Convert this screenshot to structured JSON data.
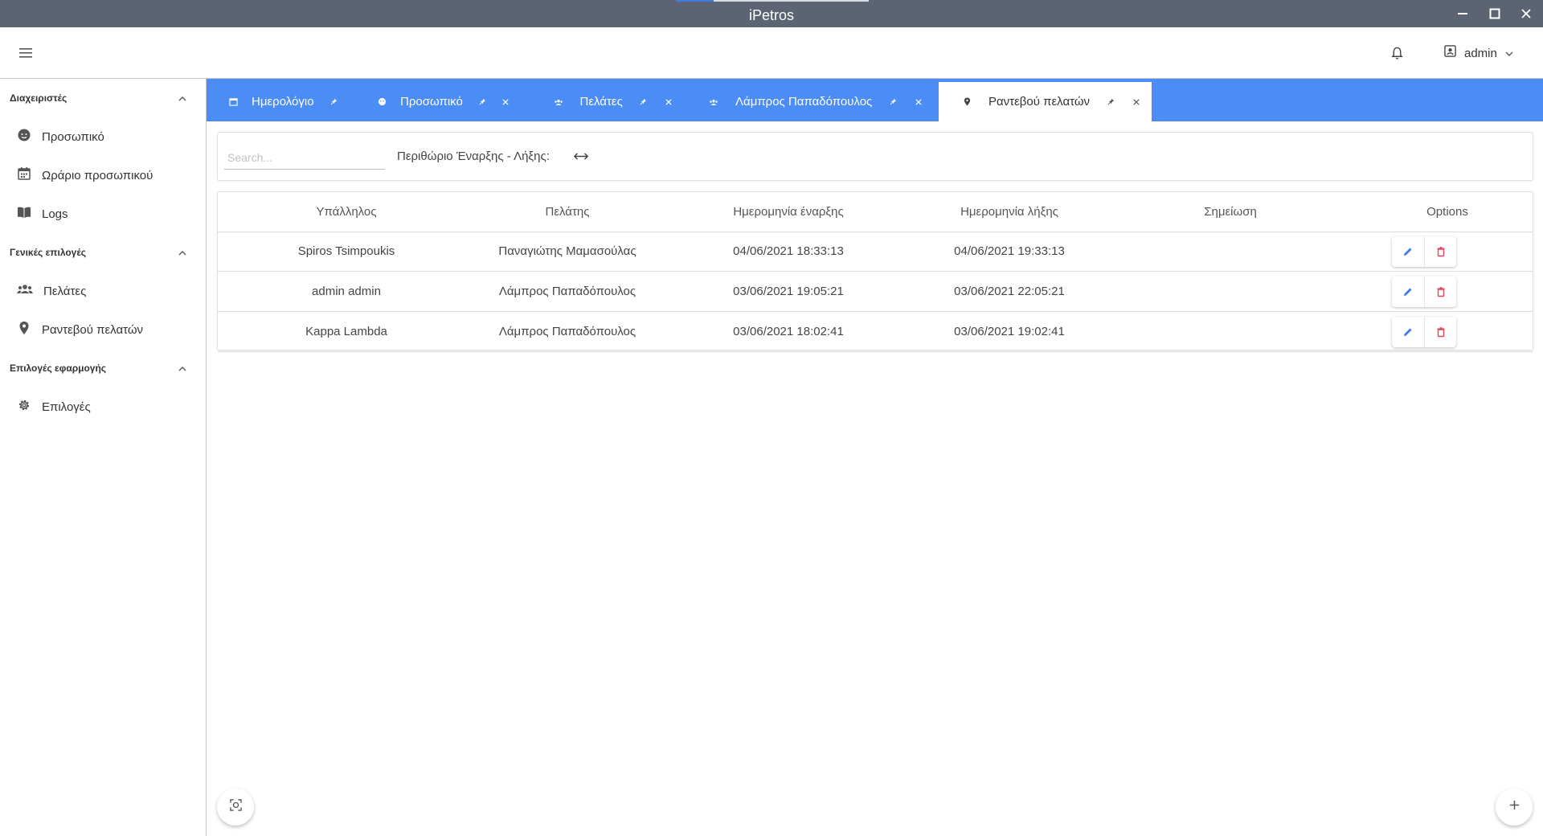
{
  "window": {
    "title": "iPetros",
    "controls": [
      "minimize-icon",
      "maximize-icon",
      "close-icon"
    ]
  },
  "header": {
    "menu_icon": "hamburger-icon",
    "notifications_icon": "bell-icon",
    "user": {
      "icon": "account-box-icon",
      "name": "admin",
      "dropdown_icon": "chevron-down-icon"
    }
  },
  "sidebar": {
    "sections": [
      {
        "title": "Διαχειριστές",
        "items": [
          {
            "label": "Προσωπικό",
            "icon": "face-icon"
          },
          {
            "label": "Ωράριο προσωπικού",
            "icon": "calendar-icon"
          },
          {
            "label": "Logs",
            "icon": "book-icon"
          }
        ]
      },
      {
        "title": "Γενικές επιλογές",
        "items": [
          {
            "label": "Πελάτες",
            "icon": "people-icon"
          },
          {
            "label": "Ραντεβού πελατών",
            "icon": "location-pin-icon"
          }
        ]
      },
      {
        "title": "Επιλογές εφαρμογής",
        "items": [
          {
            "label": "Επιλογές",
            "icon": "gear-icon"
          }
        ]
      }
    ]
  },
  "tabs": [
    {
      "label": "Ημερολόγιο",
      "icon": "calendar-icon",
      "active": false,
      "closable": false
    },
    {
      "label": "Προσωπικό",
      "icon": "face-icon",
      "active": false,
      "closable": true
    },
    {
      "label": "Πελάτες",
      "icon": "people-icon",
      "active": false,
      "closable": true
    },
    {
      "label": "Λάμπρος Παπαδόπουλος",
      "icon": "people-icon",
      "active": false,
      "closable": true
    },
    {
      "label": "Ραντεβού πελατών",
      "icon": "location-pin-icon",
      "active": true,
      "closable": true
    }
  ],
  "filter": {
    "search_placeholder": "Search...",
    "margin_label": "Περιθώριο Έναρξης - Λήξης:",
    "range_icon": "left-right-arrow-icon"
  },
  "table": {
    "columns": [
      "Υπάλληλος",
      "Πελάτης",
      "Ημερομηνία έναρξης",
      "Ημερομηνία λήξης",
      "Σημείωση",
      "Options"
    ],
    "rows": [
      [
        "Spiros Tsimpoukis",
        "Παναγιώτης Μαμασούλας",
        "04/06/2021 18:33:13",
        "04/06/2021 19:33:13",
        ""
      ],
      [
        "admin admin",
        "Λάμπρος Παπαδόπουλος",
        "03/06/2021 19:05:21",
        "03/06/2021 22:05:21",
        ""
      ],
      [
        "Kappa Lambda",
        "Λάμπρος Παπαδόπουλος",
        "03/06/2021 18:02:41",
        "03/06/2021 19:02:41",
        ""
      ]
    ],
    "row_action_icons": [
      "pencil-icon",
      "trash-icon"
    ]
  },
  "fabs": {
    "left_icon": "focus-icon",
    "right_icon": "plus-icon"
  },
  "colors": {
    "titlebar": "#5c6474",
    "tabbar": "#4b8cf5",
    "edit": "#3f7be8",
    "delete": "#e0475a"
  }
}
